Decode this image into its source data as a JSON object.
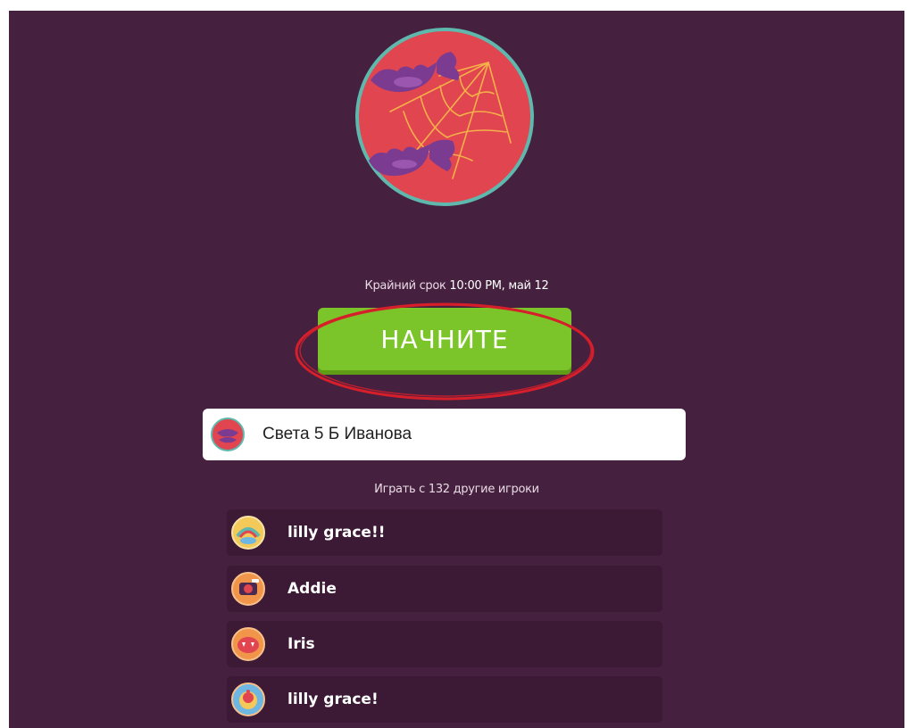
{
  "quiz": {
    "image_icon": "halloween-bats-spiderweb-icon",
    "deadline_prefix": "Крайний срок",
    "deadline_value": "10:00 PM, май 12"
  },
  "start_button": {
    "label": "НАЧНИТЕ",
    "highlight_color": "#d61f2a"
  },
  "player_name": {
    "value": "Света 5 Б Иванова",
    "avatar_icon": "red-monster-avatar-icon"
  },
  "players_label": "Играть с 132 другие игроки",
  "players": [
    {
      "name": "lilly grace!!",
      "avatar_icon": "rainbow-monster-avatar-icon"
    },
    {
      "name": "Addie",
      "avatar_icon": "camera-monster-avatar-icon"
    },
    {
      "name": "Iris",
      "avatar_icon": "red-fang-monster-avatar-icon"
    },
    {
      "name": "lilly grace!",
      "avatar_icon": "cupcake-monster-avatar-icon"
    }
  ],
  "colors": {
    "background": "#46203f",
    "accent_green": "#7bc52a",
    "row_background": "#3c1a35",
    "quiz_circle": "#e04550",
    "quiz_circle_border": "#5fb8ad"
  }
}
